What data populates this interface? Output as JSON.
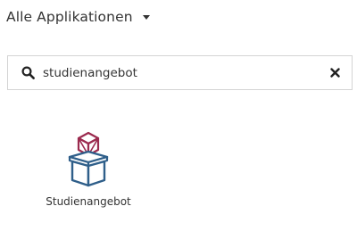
{
  "app_filter": {
    "label": "Alle Applikationen"
  },
  "search": {
    "value": "studienangebot",
    "placeholder": ""
  },
  "results": [
    {
      "label": "Studienangebot",
      "icon": "box-icon",
      "colors": {
        "top": "#9b2a4e",
        "box": "#2f5f8a"
      }
    }
  ]
}
